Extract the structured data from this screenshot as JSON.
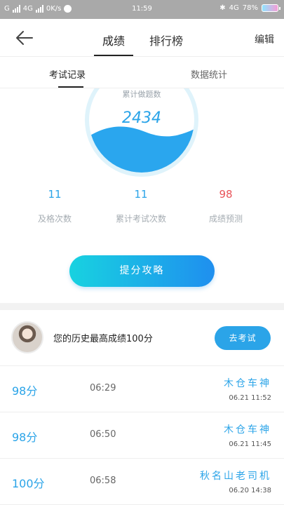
{
  "status": {
    "carrier1": "G",
    "carrier2": "4G",
    "speed": "0K/s",
    "time": "11:59",
    "network": "4G",
    "battery": "78%"
  },
  "header": {
    "tabs": [
      {
        "label": "成绩",
        "active": true
      },
      {
        "label": "排行榜",
        "active": false
      }
    ],
    "edit_label": "编辑"
  },
  "subtabs": [
    {
      "label": "考试记录",
      "active": true
    },
    {
      "label": "数据统计",
      "active": false
    }
  ],
  "gauge": {
    "label": "累计做题数",
    "value": "2434"
  },
  "stats": [
    {
      "value": "11",
      "label": "及格次数",
      "color": "#2ba4e8"
    },
    {
      "value": "11",
      "label": "累计考试次数",
      "color": "#2ba4e8"
    },
    {
      "value": "98",
      "label": "成绩预测",
      "color": "#e9545a"
    }
  ],
  "strategy_button": "提分攻略",
  "best": {
    "text": "您的历史最高成绩100分",
    "button": "去考试"
  },
  "records": [
    {
      "score": "98分",
      "duration": "06:29",
      "name": "木仓车神",
      "date": "06.21  11:52"
    },
    {
      "score": "98分",
      "duration": "06:50",
      "name": "木仓车神",
      "date": "06.21  11:45"
    },
    {
      "score": "100分",
      "duration": "06:58",
      "name": "秋名山老司机",
      "date": "06.20  14:38"
    }
  ],
  "colors": {
    "accent": "#2ba4e8",
    "danger": "#e9545a"
  }
}
